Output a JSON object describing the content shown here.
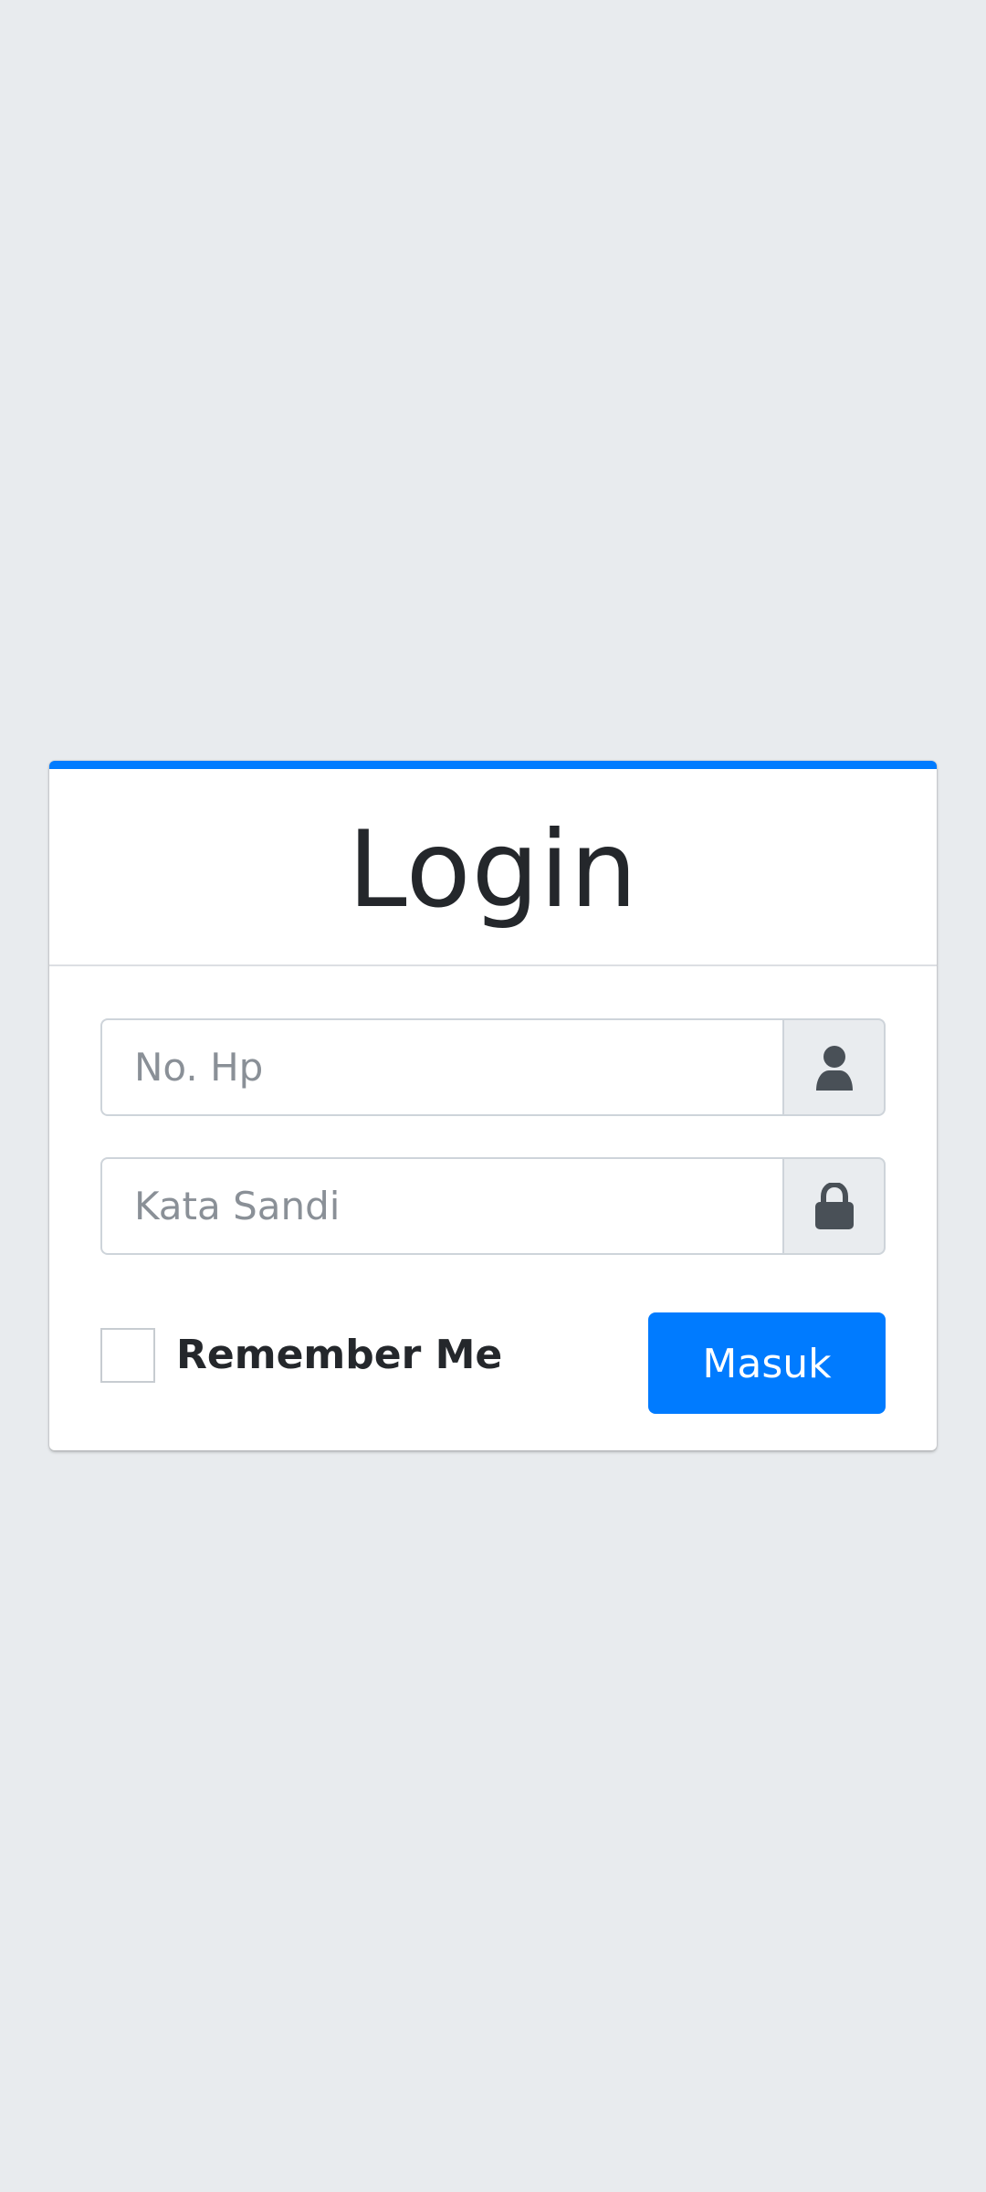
{
  "login_card": {
    "title": "Login",
    "accent_color": "#007bff",
    "phone_field": {
      "placeholder": "No. Hp",
      "value": "",
      "icon": "user-icon"
    },
    "password_field": {
      "placeholder": "Kata Sandi",
      "value": "",
      "icon": "lock-icon"
    },
    "remember_me": {
      "label": "Remember Me",
      "checked": false
    },
    "submit_button": {
      "label": "Masuk"
    }
  }
}
